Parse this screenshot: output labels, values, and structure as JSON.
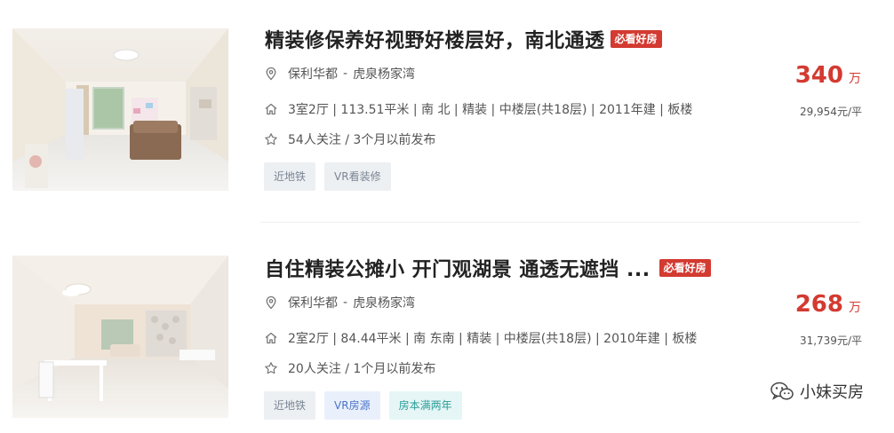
{
  "listings": [
    {
      "title": "精装修保养好视野好楼层好，南北通透",
      "badge": "必看好房",
      "community": "保利华都",
      "separator": "-",
      "area": "虎泉杨家湾",
      "attributes": "3室2厅 | 113.51平米 | 南 北 | 精装 | 中楼层(共18层) | 2011年建 | 板楼",
      "follow": "54人关注 / 3个月以前发布",
      "tags": [
        "近地铁",
        "VR看装修"
      ],
      "price": "340",
      "price_unit": "万",
      "unit_price": "29,954元/平"
    },
    {
      "title": "自住精装公摊小 开门观湖景 通透无遮挡 ...",
      "badge": "必看好房",
      "community": "保利华都",
      "separator": "-",
      "area": "虎泉杨家湾",
      "attributes": "2室2厅 | 84.44平米 | 南 东南 | 精装 | 中楼层(共18层) | 2010年建 | 板楼",
      "follow": "20人关注 / 1个月以前发布",
      "tags": [
        "近地铁",
        "VR房源",
        "房本满两年"
      ],
      "price": "268",
      "price_unit": "万",
      "unit_price": "31,739元/平"
    }
  ],
  "watermark": "小妹买房",
  "icons": {
    "location": "location-pin-icon",
    "house": "house-icon",
    "star": "star-icon",
    "wechat": "wechat-icon"
  },
  "colors": {
    "price": "#d33a31",
    "badge": "#d33a31",
    "tag_gray": "#7a8593",
    "tag_blue": "#4a74c9",
    "tag_teal": "#2a9d9a"
  }
}
